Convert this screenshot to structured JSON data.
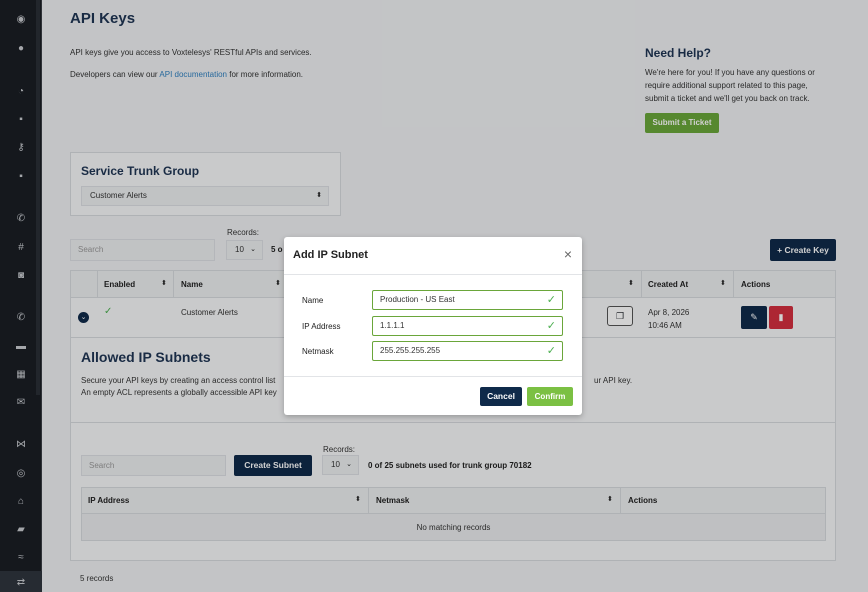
{
  "page": {
    "title": "API Keys",
    "intro_line1": "API keys give you access to Voxtelesys' RESTful APIs and services.",
    "intro_line2_prefix": "Developers can view our ",
    "intro_link": "API documentation",
    "intro_line2_suffix": " for more information."
  },
  "help": {
    "title": "Need Help?",
    "text": "We're here for you! If you have any questions or require additional support related to this page, submit a ticket and we'll get you back on track.",
    "button": "Submit a Ticket"
  },
  "trunk_group": {
    "title": "Service Trunk Group",
    "selected": "Customer Alerts"
  },
  "keys_table": {
    "search_placeholder": "Search",
    "records_label": "Records:",
    "records_value": "10",
    "count_partial": "5 o",
    "create_button": "+ Create Key",
    "headers": {
      "enabled": "Enabled",
      "name": "Name",
      "created": "Created At",
      "actions": "Actions"
    },
    "row": {
      "enabled": "✓",
      "name": "Customer Alerts",
      "created_date": "Apr 8, 2026",
      "created_time": "10:46 AM"
    },
    "footer": "5 records"
  },
  "subnets": {
    "title": "Allowed IP Subnets",
    "desc1": "Secure your API keys by creating an access control list",
    "desc1_tail": "ur API key.",
    "desc2": "An empty ACL represents a globally accessible API key",
    "search_placeholder": "Search",
    "create_button": "Create Subnet",
    "records_label": "Records:",
    "records_value": "10",
    "usage": "0 of 25 subnets used for trunk group 70182",
    "headers": {
      "ip": "IP Address",
      "netmask": "Netmask",
      "actions": "Actions"
    },
    "empty": "No matching records"
  },
  "modal": {
    "title": "Add IP Subnet",
    "fields": [
      {
        "label": "Name",
        "value": "Production - US East"
      },
      {
        "label": "IP Address",
        "value": "1.1.1.1"
      },
      {
        "label": "Netmask",
        "value": "255.255.255.255"
      }
    ],
    "cancel": "Cancel",
    "confirm": "Confirm"
  },
  "colors": {
    "navy": "#0f2a4a",
    "green": "#6aa63a",
    "danger": "#d32f3f",
    "sidebar": "#1a1e24"
  },
  "sidebar_icons": [
    "dashboard-icon",
    "user-icon",
    "speed-icon",
    "document-icon",
    "key-icon",
    "file-icon",
    "phone-icon",
    "hash-icon",
    "camera-icon",
    "call-icon",
    "chat-icon",
    "fax-icon",
    "mail-icon",
    "flow-icon",
    "data-icon",
    "bank-icon",
    "truck-icon",
    "handshake-icon",
    "transfer-icon"
  ]
}
